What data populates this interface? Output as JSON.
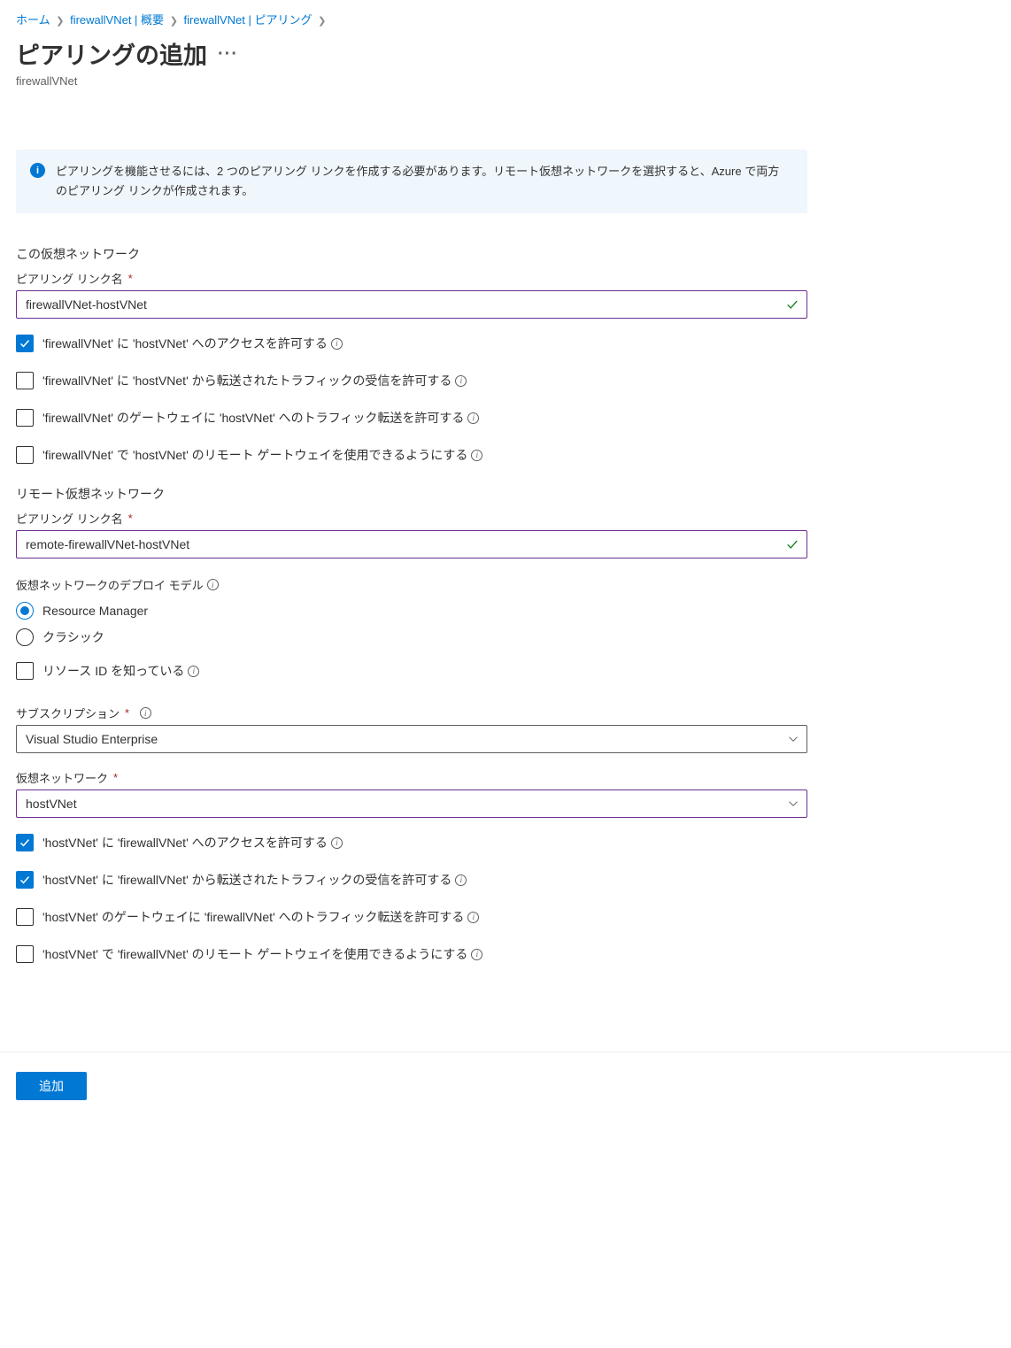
{
  "breadcrumbs": {
    "home": "ホーム",
    "vnet_overview": "firewallVNet | 概要",
    "vnet_peering": "firewallVNet | ピアリング"
  },
  "header": {
    "title": "ピアリングの追加",
    "subtitle": "firewallVNet"
  },
  "infoBanner": "ピアリングを機能させるには、2 つのピアリング リンクを作成する必要があります。リモート仮想ネットワークを選択すると、Azure で両方のピアリング リンクが作成されます。",
  "thisVnet": {
    "heading": "この仮想ネットワーク",
    "linkNameLabel": "ピアリング リンク名",
    "linkNameValue": "firewallVNet-hostVNet",
    "options": {
      "allowAccess": "'firewallVNet' に 'hostVNet' へのアクセスを許可する",
      "allowForwarded": "'firewallVNet' に 'hostVNet' から転送されたトラフィックの受信を許可する",
      "allowGatewayTransit": "'firewallVNet' のゲートウェイに 'hostVNet' へのトラフィック転送を許可する",
      "useRemoteGateways": "'firewallVNet' で 'hostVNet' のリモート ゲートウェイを使用できるようにする"
    }
  },
  "remoteVnet": {
    "heading": "リモート仮想ネットワーク",
    "linkNameLabel": "ピアリング リンク名",
    "linkNameValue": "remote-firewallVNet-hostVNet",
    "deployModelLabel": "仮想ネットワークのデプロイ モデル",
    "deployModel": {
      "rm": "Resource Manager",
      "classic": "クラシック"
    },
    "knowResourceId": "リソース ID を知っている",
    "subscriptionLabel": "サブスクリプション",
    "subscriptionValue": "Visual Studio Enterprise",
    "vnetLabel": "仮想ネットワーク",
    "vnetValue": "hostVNet",
    "options": {
      "allowAccess": "'hostVNet' に 'firewallVNet' へのアクセスを許可する",
      "allowForwarded": "'hostVNet' に 'firewallVNet' から転送されたトラフィックの受信を許可する",
      "allowGatewayTransit": "'hostVNet' のゲートウェイに 'firewallVNet' へのトラフィック転送を許可する",
      "useRemoteGateways": "'hostVNet' で 'firewallVNet' のリモート ゲートウェイを使用できるようにする"
    }
  },
  "footer": {
    "addButton": "追加"
  }
}
